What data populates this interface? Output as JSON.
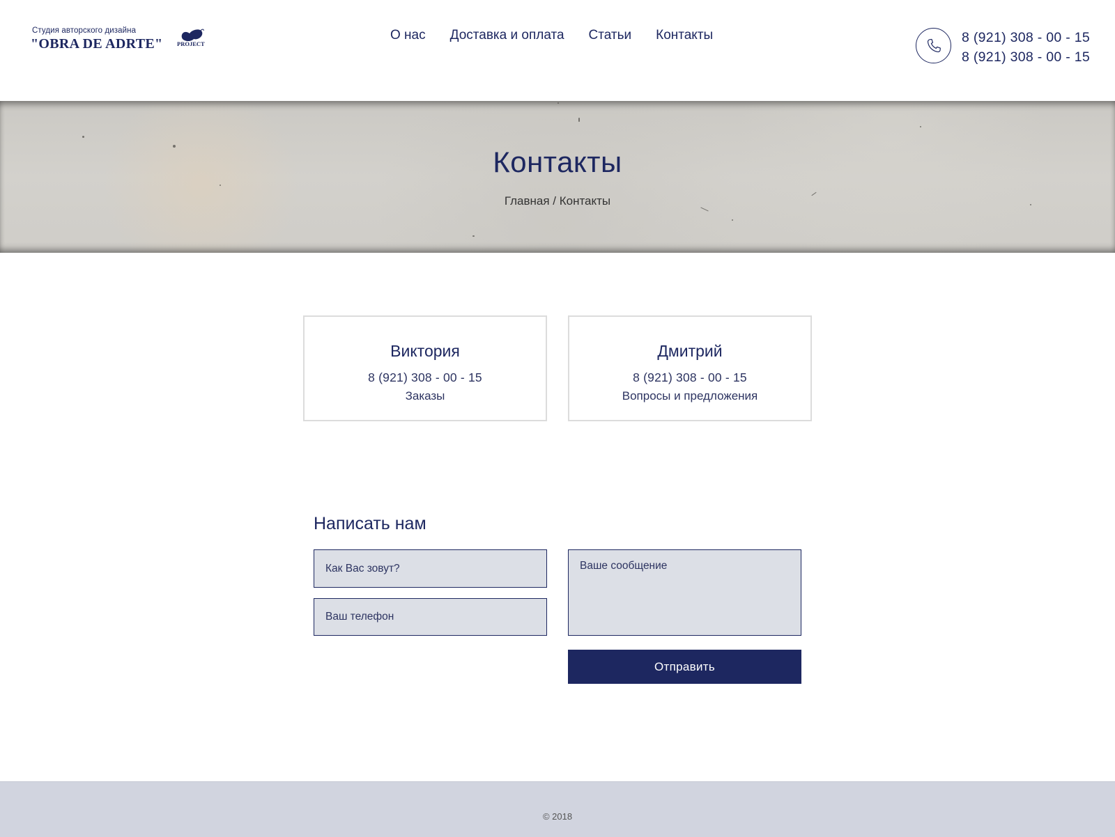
{
  "header": {
    "logo": {
      "subtitle": "Студия авторского дизайна",
      "name": "\"OBRA DE ADRTE\"",
      "suffix": "PROJECT"
    },
    "nav": [
      {
        "label": "О нас"
      },
      {
        "label": "Доставка и оплата"
      },
      {
        "label": "Статьи"
      },
      {
        "label": "Контакты"
      }
    ],
    "phones": [
      "8 (921) 308 - 00 - 15",
      "8 (921) 308 - 00 - 15"
    ],
    "phone_icon": "phone-icon"
  },
  "hero": {
    "title": "Контакты",
    "breadcrumb": {
      "home": "Главная",
      "separator": " / ",
      "current": "Контакты"
    }
  },
  "contacts": [
    {
      "name": "Виктория",
      "phone": "8 (921) 308 - 00 - 15",
      "role": "Заказы"
    },
    {
      "name": "Дмитрий",
      "phone": "8 (921) 308 - 00 - 15",
      "role": "Вопросы и предложения"
    }
  ],
  "form": {
    "title": "Написать нам",
    "name_placeholder": "Как Вас зовут?",
    "phone_placeholder": "Ваш телефон",
    "message_placeholder": "Ваше сообщение",
    "submit_label": "Отправить"
  },
  "footer": {
    "copyright": "© 2018"
  },
  "colors": {
    "accent": "#1d2760",
    "field_bg": "#dcdfe6",
    "footer_bg": "#d1d4df"
  }
}
